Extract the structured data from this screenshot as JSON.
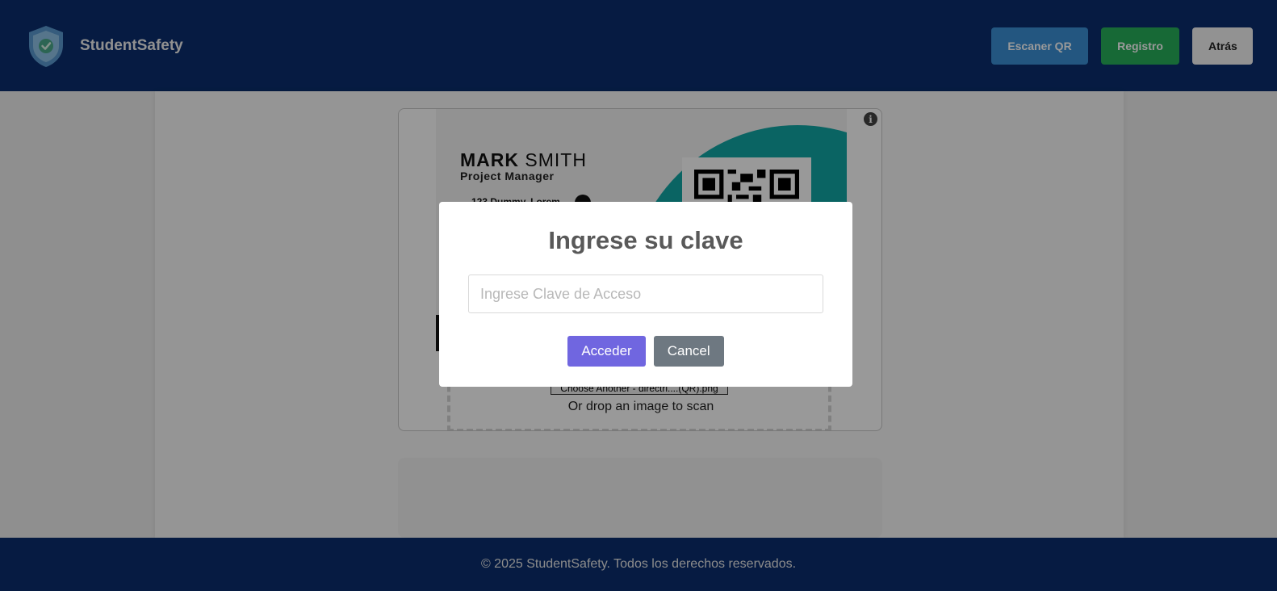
{
  "header": {
    "brand_name": "StudentSafety",
    "logo_icon": "shield-check-icon",
    "nav": {
      "scan_qr": "Escaner QR",
      "register": "Registro",
      "back": "Atrás"
    }
  },
  "scanner": {
    "info_icon": "info-icon",
    "info_glyph": "i",
    "card": {
      "first_name": "MARK",
      "last_name": "SMITH",
      "role": "Project Manager",
      "address": "123 Dummy, Lorem"
    },
    "file_button": "Choose Another - directri....(QR).png",
    "drop_text": "Or drop an image to scan"
  },
  "footer": {
    "text": "© 2025 StudentSafety. Todos los derechos reservados."
  },
  "modal": {
    "title": "Ingrese su clave",
    "input_placeholder": "Ingrese Clave de Acceso",
    "input_value": "",
    "confirm": "Acceder",
    "cancel": "Cancel"
  },
  "colors": {
    "header_bg": "#0a2e6e",
    "scan_btn": "#3b8fd6",
    "register_btn": "#27b05a",
    "back_btn": "#f4f4f4",
    "confirm_btn": "#7066e0",
    "cancel_btn": "#6e7881",
    "card_accent": "#12a7a6"
  }
}
